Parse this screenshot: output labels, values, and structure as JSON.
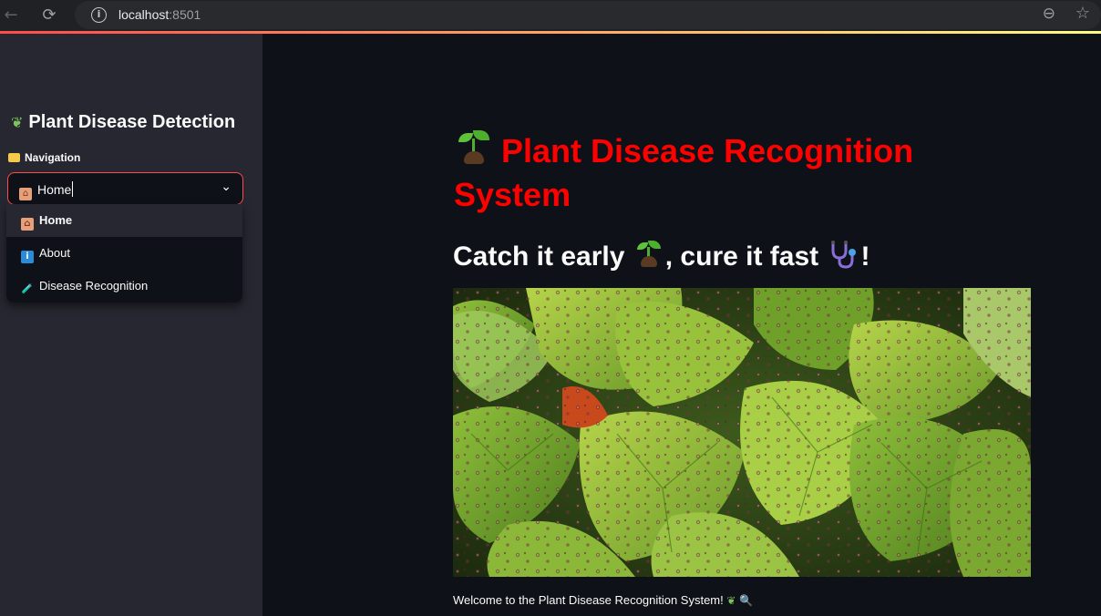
{
  "browser": {
    "url_host": "localhost",
    "url_port": ":8501"
  },
  "sidebar": {
    "title": "Plant Disease Detection",
    "nav_label": "Navigation",
    "select_value": "Home",
    "options": [
      {
        "label": "Home",
        "icon": "house-icon",
        "selected": true
      },
      {
        "label": "About",
        "icon": "info-icon",
        "selected": false
      },
      {
        "label": "Disease Recognition",
        "icon": "test-tube-icon",
        "selected": false
      }
    ]
  },
  "main": {
    "title": "Plant Disease Recognition System",
    "tagline_part1": "Catch it early",
    "tagline_part2": ", cure it fast",
    "tagline_part3": "!",
    "caption": "Welcome to the Plant Disease Recognition System!"
  },
  "colors": {
    "accent": "#ff4b4b",
    "title_red": "#ff0000",
    "sidebar_bg": "#262730",
    "main_bg": "#0e1117"
  }
}
